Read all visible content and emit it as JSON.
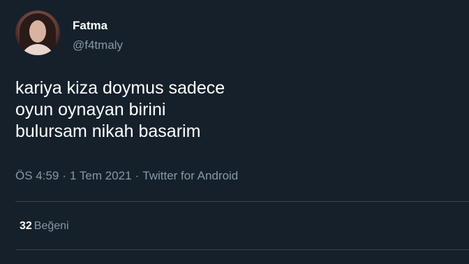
{
  "tweet": {
    "author": {
      "name": "Fatma",
      "handle": "@f4tmaly"
    },
    "text_lines": [
      "kariya kiza doymus sadece",
      "oyun oynayan birini",
      "bulursam nikah basarim"
    ],
    "meta": {
      "time": "ÖS 4:59",
      "date": "1 Tem 2021",
      "source": "Twitter for Android"
    },
    "stats": {
      "likes_count": "32",
      "likes_label": "Beğeni"
    }
  },
  "colors": {
    "background": "#15202b",
    "secondary_text": "#8899a6",
    "divider": "#38444d"
  }
}
